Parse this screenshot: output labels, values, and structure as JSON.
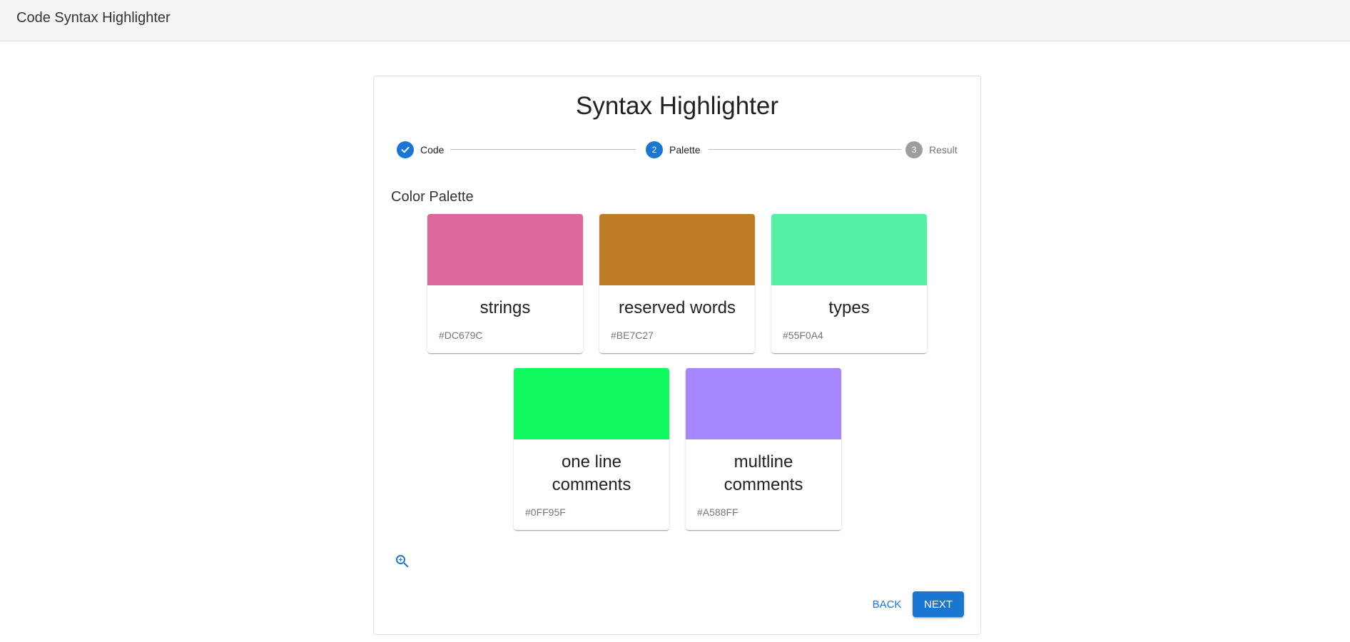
{
  "app": {
    "title": "Code Syntax Highlighter"
  },
  "panel": {
    "title": "Syntax Highlighter"
  },
  "stepper": {
    "steps": [
      {
        "label": "Code",
        "status": "completed",
        "icon": "check-icon"
      },
      {
        "label": "Palette",
        "status": "active",
        "number": "2"
      },
      {
        "label": "Result",
        "status": "pending",
        "number": "3"
      }
    ]
  },
  "palette": {
    "heading": "Color Palette",
    "items": [
      {
        "name": "strings",
        "hex": "#DC679C"
      },
      {
        "name": "reserved words",
        "hex": "#BE7C27"
      },
      {
        "name": "types",
        "hex": "#55F0A4"
      },
      {
        "name": "one line comments",
        "hex": "#0FF95F"
      },
      {
        "name": "multline comments",
        "hex": "#A588FF"
      }
    ]
  },
  "actions": {
    "back_label": "BACK",
    "next_label": "NEXT",
    "zoom_icon": "zoom-in-icon"
  },
  "colors": {
    "primary": "#1976d2",
    "inactive": "#9e9e9e"
  }
}
